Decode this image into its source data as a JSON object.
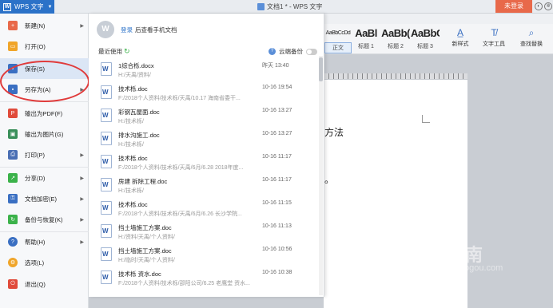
{
  "titlebar": {
    "app_name": "WPS 文字",
    "doc_title": "文档1 * - WPS 文字",
    "login_button": "未登录"
  },
  "ribbon": {
    "styles": [
      {
        "preview": "AaBbCcDd",
        "label": "正文"
      },
      {
        "preview": "AaBl",
        "label": "标题 1"
      },
      {
        "preview": "AaBb(",
        "label": "标题 2"
      },
      {
        "preview": "AaBbC",
        "label": "标题 3"
      }
    ],
    "tools": [
      {
        "label": "新样式",
        "icon": "new-style-icon"
      },
      {
        "label": "文字工具",
        "icon": "text-tool-icon"
      },
      {
        "label": "查找替换",
        "icon": "find-replace-icon"
      }
    ]
  },
  "document": {
    "text1": "方法",
    "text2": "。"
  },
  "menu": {
    "items": [
      {
        "label": "新建(N)",
        "icon": "new-doc-icon",
        "color": "#e8694a",
        "arrow": true
      },
      {
        "label": "打开(O)",
        "icon": "open-folder-icon",
        "color": "#f0a52a",
        "arrow": false
      },
      {
        "label": "保存(S)",
        "icon": "save-icon",
        "color": "#3a6fc2",
        "arrow": false
      },
      {
        "label": "另存为(A)",
        "icon": "save-as-icon",
        "color": "#3a6fc2",
        "arrow": true
      },
      {
        "label": "输出为PDF(F)",
        "icon": "pdf-icon",
        "color": "#e04b3b",
        "arrow": false
      },
      {
        "label": "输出为图片(G)",
        "icon": "image-export-icon",
        "color": "#3a8f5a",
        "arrow": false
      },
      {
        "label": "打印(P)",
        "icon": "print-icon",
        "color": "#4a6fb4",
        "arrow": true
      },
      {
        "label": "分享(D)",
        "icon": "share-icon",
        "color": "#3bb24a",
        "arrow": true
      },
      {
        "label": "文档加密(E)",
        "icon": "encrypt-icon",
        "color": "#3a6fc2",
        "arrow": true
      },
      {
        "label": "备份与恢复(K)",
        "icon": "backup-icon",
        "color": "#3bb24a",
        "arrow": true
      },
      {
        "label": "帮助(H)",
        "icon": "help-icon",
        "color": "#3a6fc2",
        "arrow": true
      },
      {
        "label": "选项(L)",
        "icon": "options-icon",
        "color": "#f0a52a",
        "arrow": false
      },
      {
        "label": "退出(Q)",
        "icon": "exit-icon",
        "color": "#e04b3b",
        "arrow": false
      }
    ]
  },
  "recent": {
    "login_link": "登录",
    "login_desc": "后查看手机文档",
    "header": "最近使用",
    "backup_label": "云端备份",
    "files": [
      {
        "name": "1综合栎.docx",
        "path": "H:/天禹/资料/",
        "time": "昨天 13:40"
      },
      {
        "name": "技术栎.doc",
        "path": "F:/2018个人资料/技术栎/天禹/10.17  海南省委干...",
        "time": "10-16 19:54"
      },
      {
        "name": "彩钢瓦屋面.doc",
        "path": "H:/技术栎/",
        "time": "10-16 13:27"
      },
      {
        "name": "排水沟施工.doc",
        "path": "H:/技术栎/",
        "time": "10-16 13:27"
      },
      {
        "name": "技术栎.doc",
        "path": "F:/2018个人资料/技术栎/天禹/6月/6.28  2018年度...",
        "time": "10-16 11:17"
      },
      {
        "name": "房建 拆除工程.doc",
        "path": "H:/技术栎/",
        "time": "10-16 11:17"
      },
      {
        "name": "技术栎.doc",
        "path": "F:/2018个人资料/技术栎/天禹/6月/6.26  长沙学院...",
        "time": "10-16 11:15"
      },
      {
        "name": "挡土墙施工方案.doc",
        "path": "H:/资料/天禹/个人资料/",
        "time": "10-16 11:13"
      },
      {
        "name": "挡土墙施工方案.doc",
        "path": "H:/临时/天禹/个人资料/",
        "time": "10-16 10:56"
      },
      {
        "name": "技术栎  资水.doc",
        "path": "F:/2018个人资料/技术栎/邵阳公司/6.25 老鹰堂  资水...",
        "time": "10-16 10:38"
      }
    ]
  },
  "watermark": {
    "brand": "搜狗指南",
    "url": "zhinan.sogou.com"
  }
}
